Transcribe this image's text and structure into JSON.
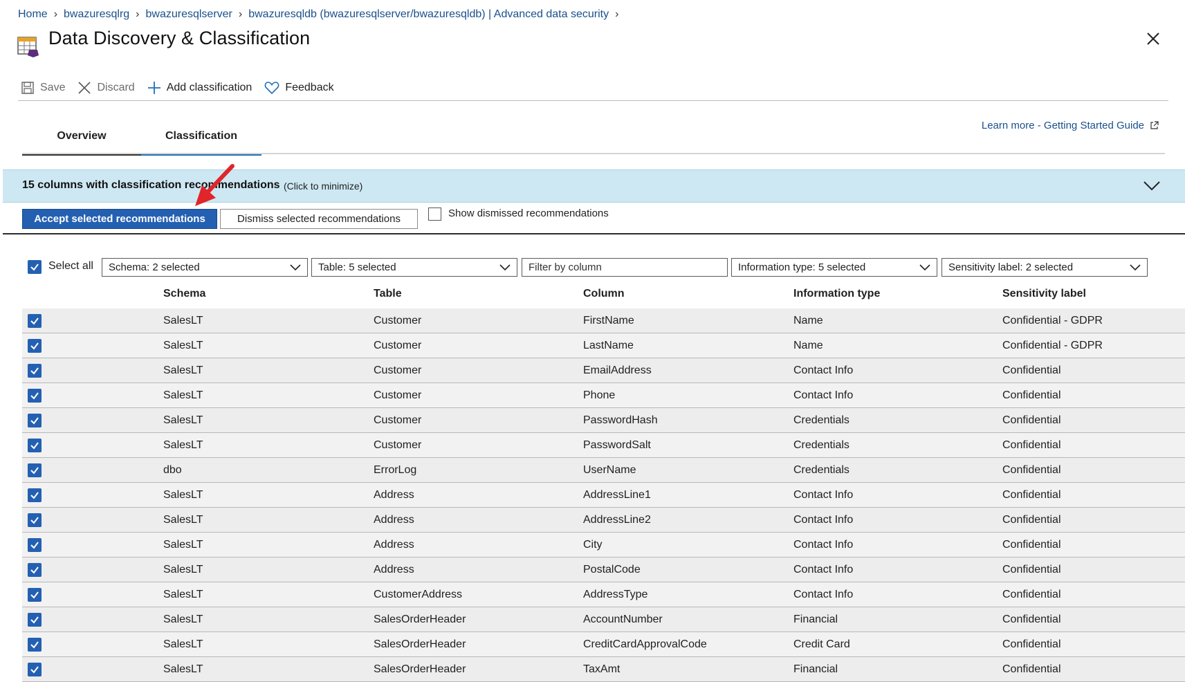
{
  "breadcrumb": [
    {
      "label": "Home"
    },
    {
      "label": "bwazuresqlrg"
    },
    {
      "label": "bwazuresqlserver"
    },
    {
      "label": "bwazuresqldb (bwazuresqlserver/bwazuresqldb) | Advanced data security"
    }
  ],
  "page": {
    "title": "Data Discovery & Classification"
  },
  "toolbar": {
    "save_label": "Save",
    "discard_label": "Discard",
    "add_label": "Add classification",
    "feedback_label": "Feedback"
  },
  "tabs": [
    {
      "label": "Overview"
    },
    {
      "label": "Classification"
    }
  ],
  "learn_more": "Learn more - Getting Started Guide",
  "banner": {
    "text": "15 columns with classification recommendations",
    "hint": "(Click to minimize)"
  },
  "actions": {
    "accept_label": "Accept selected recommendations",
    "dismiss_label": "Dismiss selected recommendations",
    "show_dismissed_label": "Show dismissed recommendations"
  },
  "filters": {
    "select_all_label": "Select all",
    "schema": "Schema: 2 selected",
    "table": "Table: 5 selected",
    "column_placeholder": "Filter by column",
    "info_type": "Information type: 5 selected",
    "sensitivity": "Sensitivity label: 2 selected"
  },
  "table": {
    "headers": [
      "Schema",
      "Table",
      "Column",
      "Information type",
      "Sensitivity label"
    ],
    "rows": [
      [
        "SalesLT",
        "Customer",
        "FirstName",
        "Name",
        "Confidential - GDPR"
      ],
      [
        "SalesLT",
        "Customer",
        "LastName",
        "Name",
        "Confidential - GDPR"
      ],
      [
        "SalesLT",
        "Customer",
        "EmailAddress",
        "Contact Info",
        "Confidential"
      ],
      [
        "SalesLT",
        "Customer",
        "Phone",
        "Contact Info",
        "Confidential"
      ],
      [
        "SalesLT",
        "Customer",
        "PasswordHash",
        "Credentials",
        "Confidential"
      ],
      [
        "SalesLT",
        "Customer",
        "PasswordSalt",
        "Credentials",
        "Confidential"
      ],
      [
        "dbo",
        "ErrorLog",
        "UserName",
        "Credentials",
        "Confidential"
      ],
      [
        "SalesLT",
        "Address",
        "AddressLine1",
        "Contact Info",
        "Confidential"
      ],
      [
        "SalesLT",
        "Address",
        "AddressLine2",
        "Contact Info",
        "Confidential"
      ],
      [
        "SalesLT",
        "Address",
        "City",
        "Contact Info",
        "Confidential"
      ],
      [
        "SalesLT",
        "Address",
        "PostalCode",
        "Contact Info",
        "Confidential"
      ],
      [
        "SalesLT",
        "CustomerAddress",
        "AddressType",
        "Contact Info",
        "Confidential"
      ],
      [
        "SalesLT",
        "SalesOrderHeader",
        "AccountNumber",
        "Financial",
        "Confidential"
      ],
      [
        "SalesLT",
        "SalesOrderHeader",
        "CreditCardApprovalCode",
        "Credit Card",
        "Confidential"
      ],
      [
        "SalesLT",
        "SalesOrderHeader",
        "TaxAmt",
        "Financial",
        "Confidential"
      ]
    ]
  },
  "colors": {
    "accent": "#2460b2",
    "banner": "#cde8f3",
    "link": "#1a4f8c",
    "arrow": "#e0262b"
  }
}
